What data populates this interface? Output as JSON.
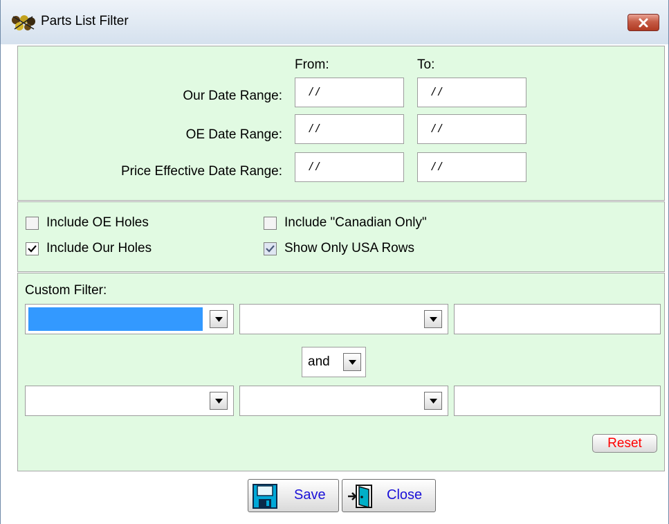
{
  "window": {
    "title": "Parts List Filter",
    "app_icon": "parts-app-icon",
    "close_icon": "close-icon"
  },
  "date_section": {
    "from_header": "From:",
    "to_header": "To:",
    "rows": [
      {
        "label": "Our Date Range:",
        "from": "/ /",
        "to": "/ /"
      },
      {
        "label": "OE Date Range:",
        "from": "/ /",
        "to": "/ /"
      },
      {
        "label": "Price  Effective Date Range:",
        "from": "/ /",
        "to": "/ /"
      }
    ]
  },
  "options": {
    "include_oe_holes": {
      "label": "Include OE Holes",
      "checked": false
    },
    "include_our_holes": {
      "label": "Include Our Holes",
      "checked": true
    },
    "include_canadian_only": {
      "label": "Include \"Canadian Only\"",
      "checked": false
    },
    "show_only_usa_rows": {
      "label": "Show Only USA Rows",
      "checked": true
    }
  },
  "custom_filter": {
    "label": "Custom Filter:",
    "row1": {
      "field": "",
      "operator": "",
      "value": ""
    },
    "conjunction": "and",
    "row2": {
      "field": "",
      "operator": "",
      "value": ""
    },
    "reset_label": "Reset"
  },
  "buttons": {
    "save_label": "Save",
    "close_label": "Close",
    "save_icon": "floppy-disk-icon",
    "close_icon": "exit-door-icon"
  },
  "colors": {
    "panel_bg": "#e1fae2",
    "selection": "#3399ff",
    "button_text": "#1a10d8",
    "reset_text": "#ff0000",
    "close_button": "#c65c46"
  }
}
